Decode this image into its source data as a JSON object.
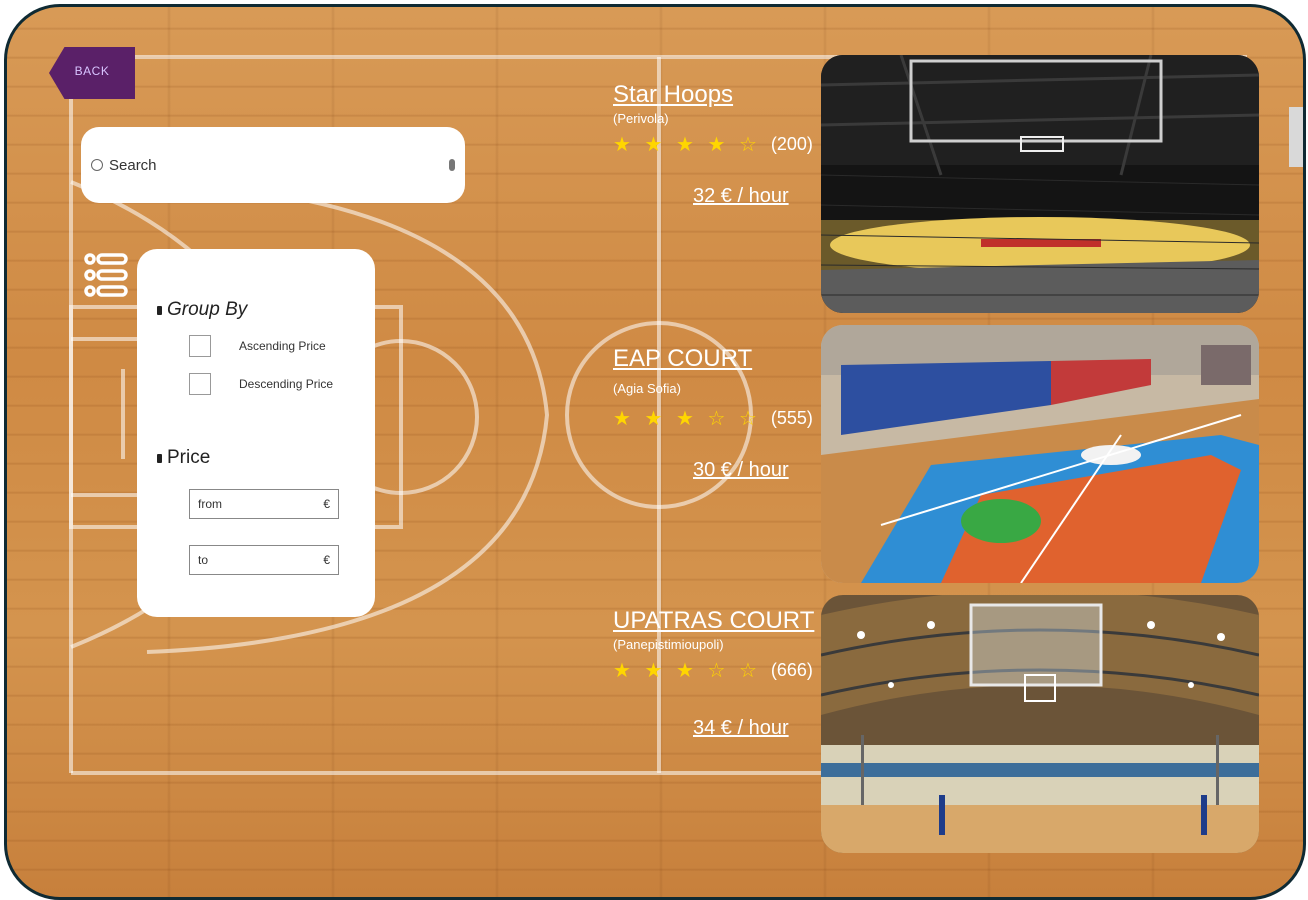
{
  "back_label": "BACK",
  "search": {
    "placeholder": "Search"
  },
  "filters": {
    "group_by_title": "Group By",
    "ascending_label": "Ascending Price",
    "descending_label": "Descending Price",
    "price_title": "Price",
    "from_label": "from",
    "to_label": "to",
    "currency": "€"
  },
  "venues": [
    {
      "name": "Star Hoops",
      "area": "(Perivola)",
      "stars": "★ ★ ★ ★ ☆",
      "rating_out_of_5": 4,
      "reviews": "(200)",
      "price": "32 € / hour"
    },
    {
      "name": "EAP COURT",
      "area": "(Agia Sofia)",
      "stars": "★ ★ ★ ☆ ☆",
      "rating_out_of_5": 3,
      "reviews": "(555)",
      "price": "30 € / hour"
    },
    {
      "name": "UPATRAS COURT",
      "area": "(Panepistimioupoli)",
      "stars": "★ ★ ★ ☆ ☆",
      "rating_out_of_5": 3,
      "reviews": "(666)",
      "price": "34 € / hour"
    }
  ],
  "colors": {
    "back_button": "#5a2068",
    "star": "#ffd600",
    "frame_border": "#0f2a33"
  }
}
